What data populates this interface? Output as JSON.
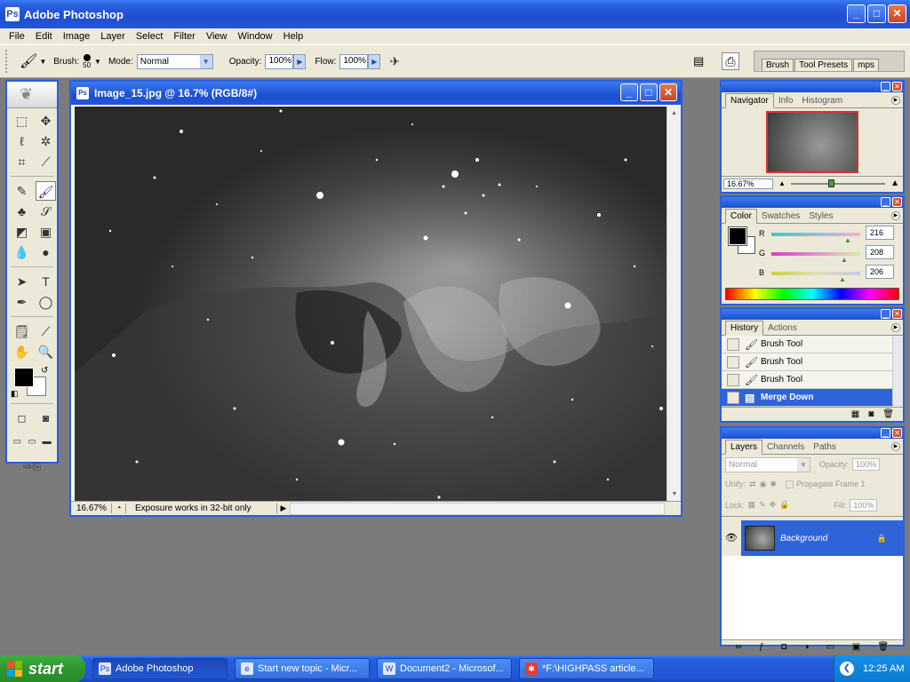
{
  "app": {
    "title": "Adobe Photoshop"
  },
  "menu": [
    "File",
    "Edit",
    "Image",
    "Layer",
    "Select",
    "Filter",
    "View",
    "Window",
    "Help"
  ],
  "options": {
    "brush_label": "Brush:",
    "brush_size": "50",
    "mode_label": "Mode:",
    "mode_value": "Normal",
    "opacity_label": "Opacity:",
    "opacity_value": "100%",
    "flow_label": "Flow:",
    "flow_value": "100%",
    "well_tabs": [
      "Brush",
      "Tool Presets",
      "mps"
    ]
  },
  "document": {
    "title": "Image_15.jpg @ 16.7% (RGB/8#)",
    "zoom": "16.67%",
    "status": "Exposure works in 32-bit only"
  },
  "navigator": {
    "tabs": [
      "Navigator",
      "Info",
      "Histogram"
    ],
    "zoom": "16.67%"
  },
  "color": {
    "tabs": [
      "Color",
      "Swatches",
      "Styles"
    ],
    "r_label": "R",
    "r_value": "216",
    "g_label": "G",
    "g_value": "208",
    "b_label": "B",
    "b_value": "206"
  },
  "history": {
    "tabs": [
      "History",
      "Actions"
    ],
    "items": [
      "Brush Tool",
      "Brush Tool",
      "Brush Tool",
      "Merge Down"
    ],
    "selected_index": 3
  },
  "layers": {
    "tabs": [
      "Layers",
      "Channels",
      "Paths"
    ],
    "blend_mode": "Normal",
    "opacity_label": "Opacity:",
    "opacity_value": "100%",
    "unify_label": "Unify:",
    "propagate_label": "Propagate Frame 1",
    "lock_label": "Lock:",
    "fill_label": "Fill:",
    "fill_value": "100%",
    "layer_name": "Background"
  },
  "taskbar": {
    "start_label": "start",
    "tasks": [
      "Adobe Photoshop",
      "Start new topic - Micr...",
      "Document2 - Microsof...",
      "*F:\\HIGHPASS article..."
    ],
    "clock": "12:25 AM"
  },
  "colors": {
    "xp_blue": "#2456d8",
    "selection_blue": "#2f63d8",
    "panel_bg": "#ece9d8",
    "workspace_gray": "#7b7b7b"
  }
}
